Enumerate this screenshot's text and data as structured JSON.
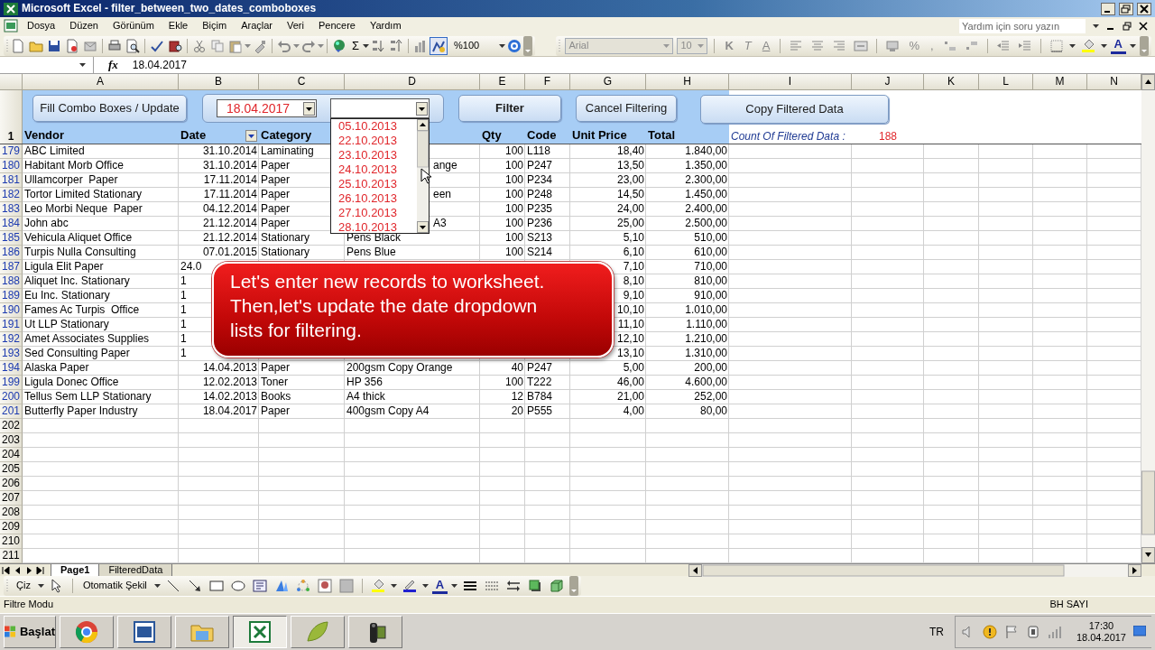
{
  "window": {
    "title": "Microsoft Excel - filter_between_two_dates_comboboxes"
  },
  "menu": [
    "Dosya",
    "Düzen",
    "Görünüm",
    "Ekle",
    "Biçim",
    "Araçlar",
    "Veri",
    "Pencere",
    "Yardım"
  ],
  "help_box": {
    "placeholder": "Yardım için soru yazın"
  },
  "standard_toolbar": {
    "autosum": "Σ",
    "zoom": "%100"
  },
  "formatting_toolbar": {
    "disabled": true,
    "font": "Arial",
    "size": "10",
    "style_buttons": [
      "K",
      "T",
      "A"
    ],
    "number_buttons": [
      "%",
      ","
    ],
    "font_color": "A"
  },
  "formula_bar": {
    "function_label": "fx",
    "value": "18.04.2017"
  },
  "columns": [
    "A",
    "B",
    "C",
    "D",
    "E",
    "F",
    "G",
    "H",
    "I",
    "J",
    "K",
    "L",
    "M",
    "N"
  ],
  "sheet_buttons": [
    {
      "label": "Fill Combo Boxes / Update",
      "bold": false
    },
    {
      "label": "Filter",
      "bold": true
    },
    {
      "label": "Cancel Filtering",
      "bold": false
    },
    {
      "label": "Copy Filtered Data",
      "bold": false
    }
  ],
  "date_from": {
    "value": "18.04.2017"
  },
  "date_to": {
    "expanded": true,
    "options": [
      "05.10.2013",
      "22.10.2013",
      "23.10.2013",
      "24.10.2013",
      "25.10.2013",
      "26.10.2013",
      "27.10.2013",
      "28.10.2013"
    ]
  },
  "header_row": {
    "number": "1",
    "headers_left": [
      {
        "text": "Vendor",
        "filter": false
      },
      {
        "text": "Date",
        "filter": true
      },
      {
        "text": "Category",
        "filter": false
      }
    ],
    "headers_right": [
      {
        "text": "Qty",
        "filter": false
      },
      {
        "text": "Code",
        "filter": false
      },
      {
        "text": "Unit Price",
        "filter": false
      },
      {
        "text": "Total",
        "filter": false
      }
    ],
    "count_label": "Count Of Filtered Data :",
    "count_value": "188"
  },
  "rows": [
    {
      "number": "179",
      "filtered": true,
      "under_list": false,
      "under_callout": false,
      "cells": [
        "ABC Limited",
        "31.10.2014",
        "Laminating",
        null,
        "100",
        "L118",
        "18,40",
        "1.840,00"
      ]
    },
    {
      "number": "180",
      "filtered": true,
      "under_list": true,
      "under_callout": false,
      "cells": [
        "Habitant Morb Office",
        "31.10.2014",
        "Paper",
        "ange",
        "100",
        "P247",
        "13,50",
        "1.350,00"
      ]
    },
    {
      "number": "181",
      "filtered": true,
      "under_list": false,
      "under_callout": false,
      "cells": [
        "Ullamcorper  Paper",
        "17.11.2014",
        "Paper",
        null,
        "100",
        "P234",
        "23,00",
        "2.300,00"
      ]
    },
    {
      "number": "182",
      "filtered": true,
      "under_list": true,
      "under_callout": false,
      "cells": [
        "Tortor Limited Stationary",
        "17.11.2014",
        "Paper",
        "een",
        "100",
        "P248",
        "14,50",
        "1.450,00"
      ]
    },
    {
      "number": "183",
      "filtered": true,
      "under_list": false,
      "under_callout": false,
      "cells": [
        "Leo Morbi Neque  Paper",
        "04.12.2014",
        "Paper",
        null,
        "100",
        "P235",
        "24,00",
        "2.400,00"
      ]
    },
    {
      "number": "184",
      "filtered": true,
      "under_list": true,
      "under_callout": false,
      "cells": [
        "John abc",
        "21.12.2014",
        "Paper",
        "A3",
        "100",
        "P236",
        "25,00",
        "2.500,00"
      ]
    },
    {
      "number": "185",
      "filtered": true,
      "under_list": false,
      "under_callout": false,
      "cells": [
        "Vehicula Aliquet Office",
        "21.12.2014",
        "Stationary",
        "Pens Black",
        "100",
        "S213",
        "5,10",
        "510,00"
      ]
    },
    {
      "number": "186",
      "filtered": true,
      "under_list": false,
      "under_callout": false,
      "cells": [
        "Turpis Nulla Consulting",
        "07.01.2015",
        "Stationary",
        "Pens Blue",
        "100",
        "S214",
        "6,10",
        "610,00"
      ]
    },
    {
      "number": "187",
      "filtered": true,
      "under_list": false,
      "under_callout": true,
      "cells": [
        "Ligula Elit Paper",
        "24.0",
        null,
        null,
        null,
        null,
        "7,10",
        "710,00"
      ]
    },
    {
      "number": "188",
      "filtered": true,
      "under_list": false,
      "under_callout": true,
      "cells": [
        "Aliquet Inc. Stationary",
        "1",
        null,
        null,
        null,
        null,
        "8,10",
        "810,00"
      ]
    },
    {
      "number": "189",
      "filtered": true,
      "under_list": false,
      "under_callout": true,
      "cells": [
        "Eu Inc. Stationary",
        "1",
        null,
        null,
        null,
        null,
        "9,10",
        "910,00"
      ]
    },
    {
      "number": "190",
      "filtered": true,
      "under_list": false,
      "under_callout": true,
      "cells": [
        "Fames Ac Turpis  Office",
        "1",
        null,
        null,
        null,
        null,
        "10,10",
        "1.010,00"
      ]
    },
    {
      "number": "191",
      "filtered": true,
      "under_list": false,
      "under_callout": true,
      "cells": [
        "Ut LLP Stationary",
        "1",
        null,
        null,
        null,
        null,
        "11,10",
        "1.110,00"
      ]
    },
    {
      "number": "192",
      "filtered": true,
      "under_list": false,
      "under_callout": true,
      "cells": [
        "Amet Associates Supplies",
        "1",
        null,
        null,
        null,
        null,
        "12,10",
        "1.210,00"
      ]
    },
    {
      "number": "193",
      "filtered": true,
      "under_list": false,
      "under_callout": true,
      "cells": [
        "Sed Consulting Paper",
        "1",
        null,
        null,
        null,
        null,
        "13,10",
        "1.310,00"
      ]
    },
    {
      "number": "194",
      "filtered": true,
      "under_list": false,
      "under_callout": false,
      "cells": [
        "Alaska Paper",
        "14.04.2013",
        "Paper",
        "200gsm Copy Orange",
        "40",
        "P247",
        "5,00",
        "200,00"
      ]
    },
    {
      "number": "199",
      "filtered": true,
      "under_list": false,
      "under_callout": false,
      "cells": [
        "Ligula Donec Office",
        "12.02.2013",
        "Toner",
        "HP 356",
        "100",
        "T222",
        "46,00",
        "4.600,00"
      ]
    },
    {
      "number": "200",
      "filtered": true,
      "under_list": false,
      "under_callout": false,
      "cells": [
        "Tellus Sem LLP Stationary",
        "14.02.2013",
        "Books",
        "A4 thick",
        "12",
        "B784",
        "21,00",
        "252,00"
      ]
    },
    {
      "number": "201",
      "filtered": true,
      "under_list": false,
      "under_callout": false,
      "cells": [
        "Butterfly Paper Industry",
        "18.04.2017",
        "Paper",
        "400gsm Copy A4",
        "20",
        "P555",
        "4,00",
        "80,00"
      ]
    },
    {
      "number": "202",
      "filtered": false
    },
    {
      "number": "203",
      "filtered": false
    },
    {
      "number": "204",
      "filtered": false
    },
    {
      "number": "205",
      "filtered": false
    },
    {
      "number": "206",
      "filtered": false
    },
    {
      "number": "207",
      "filtered": false
    },
    {
      "number": "208",
      "filtered": false
    },
    {
      "number": "209",
      "filtered": false
    },
    {
      "number": "210",
      "filtered": false
    },
    {
      "number": "211",
      "filtered": false
    }
  ],
  "callout": {
    "text": "Let's enter new records to worksheet. Then,let's update the date dropdown lists for filtering."
  },
  "sheet_tabs": [
    {
      "label": "Page1",
      "selected": true
    },
    {
      "label": "FilteredData",
      "selected": false
    }
  ],
  "drawing_toolbar": {
    "draw": "Çiz",
    "autoshapes": "Otomatik Şekil",
    "font_color": "A"
  },
  "status_bar": {
    "mode": "Filtre Modu",
    "indicators": "BH SAYI"
  },
  "taskbar": {
    "start": "Başlat",
    "apps": [
      {
        "kind": "browser",
        "selected": false
      },
      {
        "kind": "document",
        "selected": false
      },
      {
        "kind": "folder",
        "selected": false
      },
      {
        "kind": "spreadsheet",
        "selected": true
      },
      {
        "kind": "image",
        "selected": false
      },
      {
        "kind": "camera",
        "selected": false
      }
    ],
    "language": "TR",
    "time": "17:30",
    "date": "18.04.2017"
  }
}
